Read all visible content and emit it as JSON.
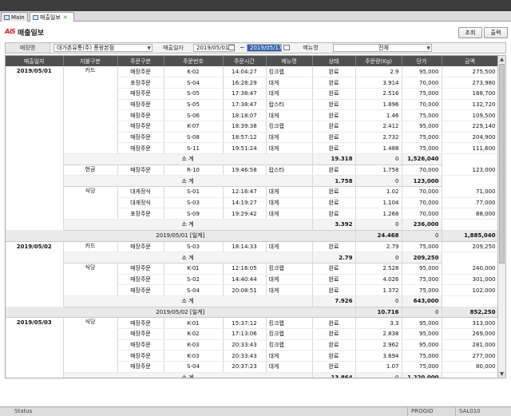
{
  "tabs": [
    {
      "label": "Main"
    },
    {
      "label": "매출일보"
    }
  ],
  "header": {
    "logo": "AiS",
    "title": "매출일보",
    "lookup_label": "조회",
    "print_label": "출력"
  },
  "filters": {
    "store_label": "매장명",
    "store_value": "대가촌유통(주) 풍왕본점",
    "date_label": "매출일자",
    "date_from": "2019/05/01",
    "tilde": "~",
    "date_to": "2019/05/17",
    "menu_label": "메뉴명",
    "menu_value": "전체"
  },
  "table": {
    "columns": [
      "매출일자",
      "지불구분",
      "주문구분",
      "주문번호",
      "주문시간",
      "메뉴명",
      "상태",
      "주문량(Kg)",
      "단가",
      "금액"
    ],
    "subtotal_label": "소 계",
    "rows": [
      {
        "t": "d",
        "date": "2019/05/01",
        "pay": "카드",
        "type": "매장주문",
        "no": "K-02",
        "time": "14:04:27",
        "menu": "킹크랩",
        "status": "완료",
        "qty": "2.9",
        "price": "95,000",
        "amount": "275,500"
      },
      {
        "t": "d",
        "type": "포장주문",
        "no": "S-04",
        "time": "16:28:29",
        "menu": "대게",
        "status": "완료",
        "qty": "3.914",
        "price": "70,000",
        "amount": "273,980"
      },
      {
        "t": "d",
        "type": "매장주문",
        "no": "S-05",
        "time": "17:38:47",
        "menu": "대게",
        "status": "완료",
        "qty": "2.516",
        "price": "75,000",
        "amount": "188,700"
      },
      {
        "t": "d",
        "type": "매장주문",
        "no": "S-05",
        "time": "17:38:47",
        "menu": "랍스타",
        "status": "완료",
        "qty": "1.896",
        "price": "70,000",
        "amount": "132,720"
      },
      {
        "t": "d",
        "type": "매장주문",
        "no": "S-06",
        "time": "18:18:07",
        "menu": "대게",
        "status": "완료",
        "qty": "1.46",
        "price": "75,000",
        "amount": "109,500"
      },
      {
        "t": "d",
        "type": "매장주문",
        "no": "K-07",
        "time": "18:39:38",
        "menu": "킹크랩",
        "status": "완료",
        "qty": "2.412",
        "price": "95,000",
        "amount": "229,140"
      },
      {
        "t": "d",
        "type": "매장주문",
        "no": "S-08",
        "time": "18:57:12",
        "menu": "대게",
        "status": "완료",
        "qty": "2.732",
        "price": "75,000",
        "amount": "204,900"
      },
      {
        "t": "d",
        "type": "매장주문",
        "no": "S-11",
        "time": "19:51:24",
        "menu": "대게",
        "status": "완료",
        "qty": "1.488",
        "price": "75,000",
        "amount": "111,600"
      },
      {
        "t": "s",
        "qty": "19.318",
        "price": "0",
        "amount": "1,526,040"
      },
      {
        "t": "d",
        "pay": "현금",
        "type": "매장주문",
        "no": "R-10",
        "time": "19:46:58",
        "menu": "랍스타",
        "status": "완료",
        "qty": "1.758",
        "price": "70,000",
        "amount": "123,000"
      },
      {
        "t": "s",
        "qty": "1.758",
        "price": "0",
        "amount": "123,000"
      },
      {
        "t": "d",
        "pay": "식당",
        "type": "대게정식",
        "no": "S-01",
        "time": "12:16:47",
        "menu": "대게",
        "status": "완료",
        "qty": "1.02",
        "price": "70,000",
        "amount": "71,000"
      },
      {
        "t": "d",
        "type": "대게정식",
        "no": "S-03",
        "time": "14:19:27",
        "menu": "대게",
        "status": "완료",
        "qty": "1.104",
        "price": "70,000",
        "amount": "77,000"
      },
      {
        "t": "d",
        "type": "포장주문",
        "no": "S-09",
        "time": "19:29:42",
        "menu": "대게",
        "status": "완료",
        "qty": "1.268",
        "price": "70,000",
        "amount": "88,000"
      },
      {
        "t": "s",
        "qty": "3.392",
        "price": "0",
        "amount": "236,000"
      },
      {
        "t": "m",
        "label": "2019/05/01 [일계]",
        "qty": "24.468",
        "price": "0",
        "amount": "1,885,040"
      },
      {
        "t": "d",
        "date": "2019/05/02",
        "pay": "카드",
        "type": "매장주문",
        "no": "S-03",
        "time": "18:14:33",
        "menu": "대게",
        "status": "완료",
        "qty": "2.79",
        "price": "75,000",
        "amount": "209,250"
      },
      {
        "t": "s",
        "qty": "2.79",
        "price": "0",
        "amount": "209,250"
      },
      {
        "t": "d",
        "pay": "식당",
        "type": "매장주문",
        "no": "K-01",
        "time": "12:16:05",
        "menu": "킹크랩",
        "status": "완료",
        "qty": "2.528",
        "price": "95,000",
        "amount": "240,000"
      },
      {
        "t": "d",
        "type": "매장주문",
        "no": "S-02",
        "time": "14:40:44",
        "menu": "대게",
        "status": "완료",
        "qty": "4.026",
        "price": "75,000",
        "amount": "301,000"
      },
      {
        "t": "d",
        "type": "매장주문",
        "no": "S-04",
        "time": "20:08:51",
        "menu": "대게",
        "status": "완료",
        "qty": "1.372",
        "price": "75,000",
        "amount": "102,000"
      },
      {
        "t": "s",
        "qty": "7.926",
        "price": "0",
        "amount": "643,000"
      },
      {
        "t": "m",
        "label": "2019/05/02 [일계]",
        "qty": "10.716",
        "price": "0",
        "amount": "852,250"
      },
      {
        "t": "d",
        "date": "2019/05/03",
        "pay": "식당",
        "type": "매장주문",
        "no": "K-01",
        "time": "15:37:12",
        "menu": "킹크랩",
        "status": "완료",
        "qty": "3.3",
        "price": "95,000",
        "amount": "313,000"
      },
      {
        "t": "d",
        "type": "매장주문",
        "no": "K-02",
        "time": "17:13:06",
        "menu": "킹크랩",
        "status": "완료",
        "qty": "2.838",
        "price": "95,000",
        "amount": "269,000"
      },
      {
        "t": "d",
        "type": "매장주문",
        "no": "K-03",
        "time": "20:33:43",
        "menu": "킹크랩",
        "status": "완료",
        "qty": "2.962",
        "price": "95,000",
        "amount": "281,000"
      },
      {
        "t": "d",
        "type": "매장주문",
        "no": "K-03",
        "time": "20:33:43",
        "menu": "대게",
        "status": "완료",
        "qty": "3.694",
        "price": "75,000",
        "amount": "277,000"
      },
      {
        "t": "d",
        "type": "매장주문",
        "no": "S-04",
        "time": "20:37:23",
        "menu": "대게",
        "status": "완료",
        "qty": "1.07",
        "price": "75,000",
        "amount": "80,000"
      },
      {
        "t": "s",
        "qty": "13.864",
        "price": "0",
        "amount": "1,220,000"
      }
    ]
  },
  "status": {
    "left": "Status",
    "progid": "PROGID",
    "code": "SAL010"
  }
}
